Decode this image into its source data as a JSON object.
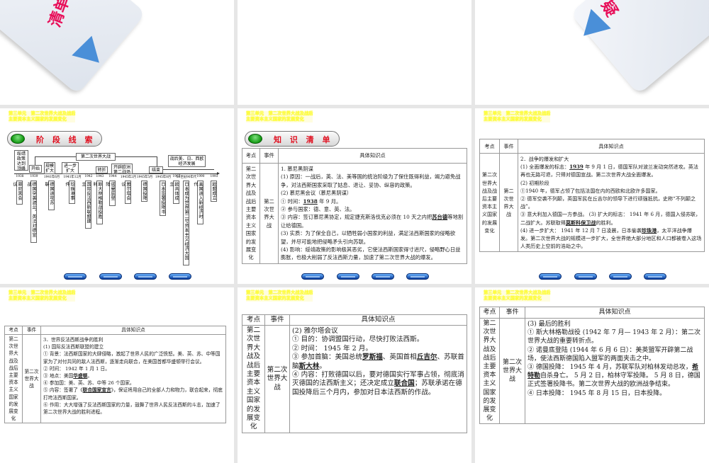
{
  "unit_title": [
    "第三单元　第二次世界大战及战后",
    "主要资本主义国家的发展变化"
  ],
  "top_left_card": "清单",
  "top_right_card": "疑",
  "timeline_slide": {
    "header": "阶 段 线 索",
    "war_label": "第二次世界大战",
    "stages": [
      "绥靖政策达到顶峰",
      "开始",
      "规模扩大",
      "进一步扩大",
      "转折",
      "开辟欧洲第二战场",
      "结束",
      "战后美、日、西欧经济发展"
    ],
    "events": [
      {
        "year": "1938",
        "label": "慕尼黑会议"
      },
      {
        "year": "1939",
        "label": "德国突袭波兰，英法对德宣战"
      },
      {
        "year": "1941年6月",
        "label": "德国进攻苏联"
      },
      {
        "year": "1941年12月",
        "label": "珍珠港事件"
      },
      {
        "year": "1942",
        "label": "国际反法西斯联盟建立"
      },
      {
        "year": "1943",
        "label": "斯大林格勒战役胜利"
      },
      {
        "year": "1944",
        "label": "诺曼底登陆"
      },
      {
        "year": "1945年2月",
        "label": "雅尔塔会议"
      },
      {
        "year": "1945年5月",
        "label": "德国投降"
      },
      {
        "year": "1945年8月",
        "label": "日本签署投降书"
      },
      {
        "year": "1967",
        "label": "欧共体成立"
      },
      {
        "year": "20世纪90年代",
        "label": "日本成为世界第二号资本主义经济大国"
      },
      {
        "year": "1990",
        "label": "美国进入新经济时代"
      },
      {
        "year": "1993",
        "label": "欧盟成立"
      }
    ]
  },
  "table_headers": {
    "kaodian": "考点",
    "shijian": "事件",
    "zhishi": "具体知识点"
  },
  "kaodian_value": "第二次世界大战及战后主要资本主义国家的发展变化",
  "shijian_value": "第二次世界大战",
  "knowledge_header": "知 识 清 单",
  "slides": [
    {
      "paras": [
        [
          "1. 慕尼黑阴谋"
        ],
        [
          "(1) 原因：一战后，英、法、美等国的统治阶级为了保住既得利益，竭力避免战争，对法西斯国家采取了姑息、退让、妥协、纵容的政策。"
        ],
        [
          "(2) 慕尼黑会议（慕尼黑阴谋）"
        ],
        [
          "① 时间：",
          {
            "u": "1938"
          },
          " 年 9 月。"
        ],
        [
          "② 参与国家：德、意、英、法。"
        ],
        [
          "③ 内容：签订慕尼黑协定，规定捷克斯洛伐克必须在 10 天之内把",
          {
            "u": "苏台德"
          },
          "等地割让给德国。"
        ],
        [
          "(3) 实质：为了保全自己，以牺牲弱小国家的利益，满足法西斯国家的侵略欲望，并尽可能地把侵略矛头引向苏联。"
        ],
        [
          "(4) 影响：绥靖政策的影响极其恶劣，它使法西斯国家得寸进尺，侵略野心日益膨胀，也极大削弱了反法西斯力量，加速了第二次世界大战的爆发。"
        ]
      ]
    },
    {
      "paras": [
        [
          "2．战争的爆发和扩大"
        ],
        [
          "(1) 全面爆发的标志：",
          {
            "u": "1939"
          },
          " 年 9 月 1 日，德国军队对波兰发动突然进攻。英法再也无路可退，只得对德国宣战。第二次世界大战全面爆发。"
        ],
        [
          "(2) 初期阶段"
        ],
        [
          "①1940 年，德军占领了包括法国在内的西欧和北欧许多国家。"
        ],
        [
          "② 德军空袭不列颠，英国军民在丘吉尔的领导下进行顽强抵抗，史称“不列颠之战”。"
        ],
        [
          "③ 意大利加入德国一方参战。 (3) 扩大的标志： 1941 年 6 月，德国入侵苏联，二战扩大。苏联取得",
          {
            "u": "莫斯科保卫战"
          },
          "的胜利。"
        ],
        [
          "(4) 进一步扩大： 1941 年 12 月 7 日凌晨，日本偷袭",
          {
            "u": "珍珠港"
          },
          "，太平洋战争爆发。第二次世界大战的规模进一步扩大，全世界绝大部分地区和人口都被卷入这场人类历史上空前的浩劫之中。"
        ]
      ]
    },
    {
      "paras": [
        [
          "3．世界反法西斯战争的胜利"
        ],
        [
          "(1) 国际反法西斯联盟的建立"
        ],
        [
          "① 背景：法西斯国家的大肆侵略，激起了世界人民的广泛愤怒。美、英、苏、中等国家为了对付共同的敌人法西斯，逐渐走向联合，在美国首都华盛顿举行会议。"
        ],
        [
          "② 时间： 1942 年 1 月 1 日。"
        ],
        [
          "③ 地点：美国",
          {
            "u": "华盛顿"
          },
          "。"
        ],
        [
          "④ 参加国：美、英、苏、中等 26 个国家。"
        ],
        [
          "⑤ 内容：签署了《",
          {
            "u": "联合国家宣言"
          },
          "》，保证将用自己的全部人力和物力，联合起来，彻底打垮法西斯国家。"
        ],
        [
          "⑥ 作用：大大增强了反法西斯国家的力量，鼓舞了世界人民反法西斯的斗志，加速了第二次世界大战的胜利进程。"
        ]
      ]
    },
    {
      "paras": [
        [
          "(2) 雅尔塔会议"
        ],
        [
          "① 目的：协调盟国行动，尽快打败法西斯。"
        ],
        [
          "② 时间： 1945 年 2 月。"
        ],
        [
          "③ 参加首脑：美国总统",
          {
            "u": "罗斯福"
          },
          "、英国首相",
          {
            "u": "丘吉尔"
          },
          "、苏联首脑",
          {
            "u": "斯大林"
          },
          "。"
        ],
        [
          "④ 内容：打败德国以后，要对德国实行军事占领，彻底消灭德国的法西斯主义；还决定成立",
          {
            "u": "联合国"
          },
          "；苏联承诺在德国投降后三个月内，参加对日本法西斯的作战。"
        ]
      ]
    },
    {
      "paras": [
        [
          "(3) 最后的胜利"
        ],
        [
          "① 斯大林格勒战役 (1942 年 7 月— 1943 年 2 月）：第二次世界大战的重要转折点。"
        ],
        [
          "② 诺曼底登陆 (1944 年 6 月 6 日）：美英盟军开辟第二战场，使法西斯德国陷入盟军的两面夹击之中。"
        ],
        [
          "③ 德国投降： 1945 年 4 月，苏联军队对柏林发动总攻，",
          {
            "u": "希特勒"
          },
          "自杀身亡。 5 月 2 日，柏林守军投降。 5 月 8 日，德国正式签署投降书。第二次世界大战的欧洲战争结束。"
        ],
        [
          "④ 日本投降： 1945 年 8 月 15 日，日本投降。"
        ]
      ]
    }
  ]
}
